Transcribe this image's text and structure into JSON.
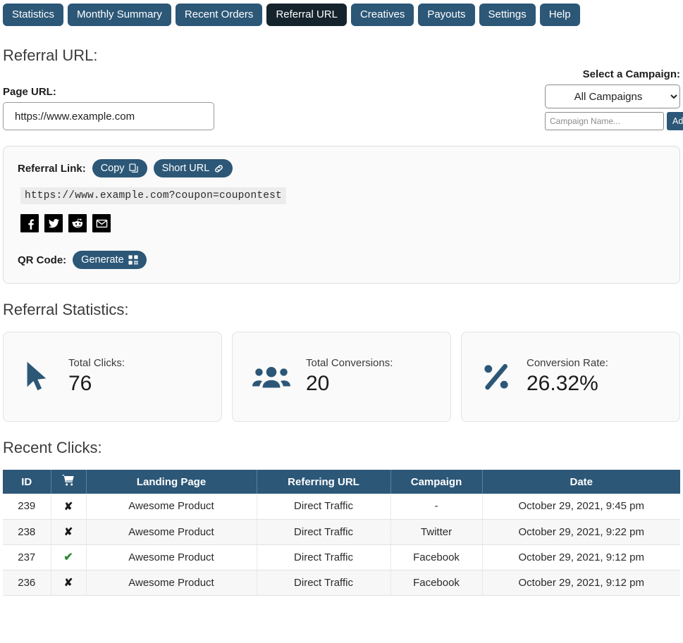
{
  "colors": {
    "tab_inactive": "#2c5777",
    "tab_active": "#15232d",
    "accent": "#2c5777",
    "check_green": "#2f8a2f",
    "panel_bg": "#fafafa"
  },
  "tabs": [
    {
      "label": "Statistics",
      "active": false
    },
    {
      "label": "Monthly Summary",
      "active": false
    },
    {
      "label": "Recent Orders",
      "active": false
    },
    {
      "label": "Referral URL",
      "active": true
    },
    {
      "label": "Creatives",
      "active": false
    },
    {
      "label": "Payouts",
      "active": false
    },
    {
      "label": "Settings",
      "active": false
    },
    {
      "label": "Help",
      "active": false
    }
  ],
  "page": {
    "title": "Referral URL:",
    "page_url_label": "Page URL:",
    "page_url_value": "https://www.example.com"
  },
  "campaign": {
    "title": "Select a Campaign:",
    "selected": "All Campaigns",
    "options": [
      "All Campaigns"
    ],
    "name_placeholder": "Campaign Name...",
    "name_value": "",
    "add_label": "Add New"
  },
  "referral": {
    "label": "Referral Link:",
    "copy_label": "Copy",
    "short_url_label": "Short URL",
    "link": "https://www.example.com?coupon=coupontest",
    "social": [
      {
        "name": "facebook-icon",
        "title": "Facebook"
      },
      {
        "name": "twitter-icon",
        "title": "Twitter"
      },
      {
        "name": "reddit-icon",
        "title": "Reddit"
      },
      {
        "name": "email-icon",
        "title": "Email"
      }
    ],
    "qr_label": "QR Code:",
    "generate_label": "Generate"
  },
  "statistics": {
    "title": "Referral Statistics:",
    "cards": [
      {
        "icon": "cursor-arrow-icon",
        "label": "Total Clicks:",
        "value": "76"
      },
      {
        "icon": "users-icon",
        "label": "Total Conversions:",
        "value": "20"
      },
      {
        "icon": "percent-icon",
        "label": "Conversion Rate:",
        "value": "26.32%"
      }
    ]
  },
  "recent_clicks": {
    "title": "Recent Clicks:",
    "columns": [
      "ID",
      "cart-plus-icon",
      "Landing Page",
      "Referring URL",
      "Campaign",
      "Date"
    ],
    "rows": [
      {
        "id": "239",
        "converted": "x",
        "landing": "Awesome Product",
        "referrer": "Direct Traffic",
        "campaign": "-",
        "date": "October 29, 2021, 9:45 pm"
      },
      {
        "id": "238",
        "converted": "x",
        "landing": "Awesome Product",
        "referrer": "Direct Traffic",
        "campaign": "Twitter",
        "date": "October 29, 2021, 9:22 pm"
      },
      {
        "id": "237",
        "converted": "check",
        "landing": "Awesome Product",
        "referrer": "Direct Traffic",
        "campaign": "Facebook",
        "date": "October 29, 2021, 9:12 pm"
      },
      {
        "id": "236",
        "converted": "x",
        "landing": "Awesome Product",
        "referrer": "Direct Traffic",
        "campaign": "Facebook",
        "date": "October 29, 2021, 9:12 pm"
      }
    ]
  }
}
